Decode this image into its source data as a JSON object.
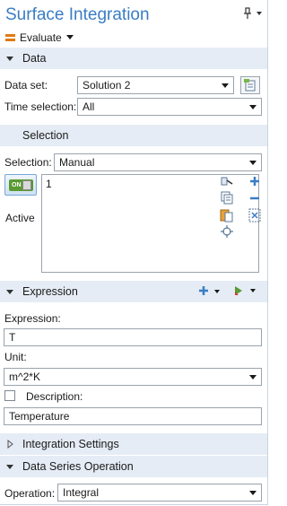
{
  "title": "Surface Integration",
  "toolbar": {
    "evaluate_label": "Evaluate"
  },
  "sections": {
    "data": "Data",
    "selection": "Selection",
    "expression": "Expression",
    "integration_settings": "Integration Settings",
    "data_series_operation": "Data Series Operation"
  },
  "data": {
    "dataset_label": "Data set:",
    "dataset_value": "Solution 2",
    "time_label": "Time selection:",
    "time_value": "All"
  },
  "selection": {
    "label": "Selection:",
    "value": "Manual",
    "toggle_text": "ON",
    "active_label": "Active",
    "items": [
      "1"
    ]
  },
  "expression": {
    "expression_label": "Expression:",
    "expression_value": "T",
    "unit_label": "Unit:",
    "unit_value": "m^2*K",
    "description_label": "Description:",
    "description_value": "Temperature",
    "description_checked": false
  },
  "operation": {
    "label": "Operation:",
    "value": "Integral"
  },
  "colors": {
    "title": "#3a7dc4",
    "section_bg": "#e5ecf5",
    "evaluate_icon": "#e07b12",
    "add_icon": "#3a7dc4",
    "toggle_on": "#5a9a32"
  },
  "icons": {
    "pin": "pin-icon",
    "evaluate": "evaluate-icon",
    "add": "plus-icon",
    "remove": "minus-icon",
    "paste": "paste-icon",
    "copy": "copy-icon",
    "clear": "clear-selection-icon",
    "zoom": "zoom-to-selection-icon",
    "create_selection": "create-selection-icon",
    "select_dataset": "go-to-source-icon",
    "insert_expression": "insert-expression-icon"
  }
}
